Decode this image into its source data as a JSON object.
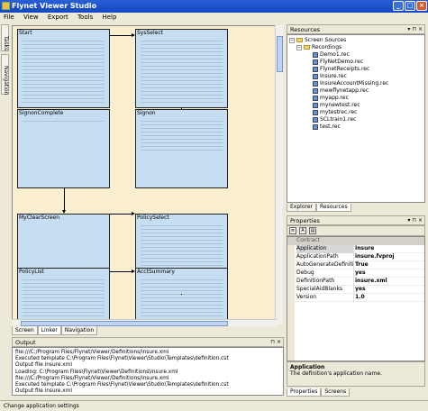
{
  "window": {
    "title": "Flynet Viewer Studio"
  },
  "menu": [
    "File",
    "View",
    "Export",
    "Tools",
    "Help"
  ],
  "left_tabs": [
    "Tasks",
    "Navigation"
  ],
  "screens": [
    {
      "id": "start",
      "title": "Start"
    },
    {
      "id": "sysselect",
      "title": "SysSelect"
    },
    {
      "id": "signoncomplete",
      "title": "SignonComplete"
    },
    {
      "id": "signon",
      "title": "Signon"
    },
    {
      "id": "myclearscreen",
      "title": "MyClearScreen"
    },
    {
      "id": "policyselect",
      "title": "PolicySelect"
    },
    {
      "id": "policylist",
      "title": "PolicyList"
    },
    {
      "id": "acctsummary",
      "title": "AcctSummary"
    }
  ],
  "bottom_tabs": [
    "Screen",
    "Linker",
    "Navigation"
  ],
  "output": {
    "title": "Output",
    "lines": [
      "file:///C:/Program Files/Flynet/Viewer/Definitions/insure.xml",
      "Executed template C:\\Program Files\\Flynet\\Viewer\\Studio\\Templates\\definition.cst",
      "Output file insure.xml",
      "Loading: C:\\Program Files\\Flynet\\Viewer\\Definitions\\insure.xml",
      "file:///C:/Program Files/Flynet/Viewer/Definitions/insure.xml",
      "Executed template C:\\Program Files\\Flynet\\Viewer\\Studio\\Templates\\definition.cst",
      "Output file insure.xml"
    ]
  },
  "resources": {
    "title": "Resources",
    "root": "Screen Sources",
    "folder": "Recordings",
    "files": [
      "Demo1.rec",
      "FlyNetDemo.rec",
      "FlynetReceipts.rec",
      "Insure.rec",
      "InsureAccountMissing.rec",
      "mewflynetapp.rec",
      "myapp.rec",
      "mynewtest.rec",
      "mytestrec.rec",
      "SCLtrain1.rec",
      "test.rec"
    ],
    "tabs": [
      "Explorer",
      "Resources"
    ]
  },
  "properties": {
    "title": "Properties",
    "category": "Contract",
    "rows": [
      {
        "key": "Application",
        "value": "Insure"
      },
      {
        "key": "ApplicationPath",
        "value": "insure.fvproj"
      },
      {
        "key": "AutoGenerateDefinition",
        "value": "True"
      },
      {
        "key": "Debug",
        "value": "yes"
      },
      {
        "key": "DefinitionPath",
        "value": "insure.xml"
      },
      {
        "key": "SpecialAidBlanks",
        "value": "yes"
      },
      {
        "key": "Version",
        "value": "1.0"
      }
    ],
    "desc_title": "Application",
    "desc_text": "The definition's application name.",
    "tabs": [
      "Properties",
      "Screens"
    ]
  },
  "status": "Change application settings"
}
